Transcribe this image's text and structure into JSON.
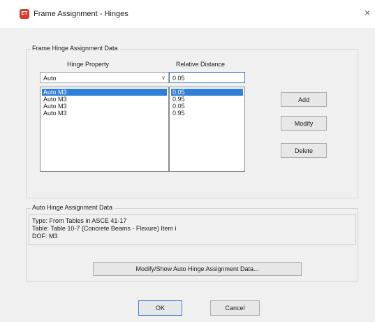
{
  "window": {
    "title": "Frame Assignment - Hinges",
    "app_icon": "ET",
    "close_glyph": "×"
  },
  "hinge_group": {
    "label": "Frame Hinge Assignment Data",
    "col_property": "Hinge Property",
    "col_distance": "Relative Distance",
    "property_select": {
      "value": "Auto",
      "arrow": "∨"
    },
    "distance_input": "0.05",
    "rows": [
      {
        "property": "Auto  M3",
        "distance": "0.05",
        "selected": true
      },
      {
        "property": "Auto  M3",
        "distance": "0.95",
        "selected": false
      },
      {
        "property": "Auto  M3",
        "distance": "0.05",
        "selected": false
      },
      {
        "property": "Auto  M3",
        "distance": "0.95",
        "selected": false
      }
    ],
    "buttons": {
      "add": "Add",
      "modify": "Modify",
      "delete": "Delete"
    }
  },
  "auto_group": {
    "label": "Auto Hinge Assignment Data",
    "lines": [
      "Type:  From Tables in ASCE 41-17",
      "Table:  Table 10-7 (Concrete Beams - Flexure) Item i",
      "DOF:  M3"
    ],
    "modify_show_button": "Modify/Show Auto Hinge Assignment Data..."
  },
  "footer": {
    "ok": "OK",
    "cancel": "Cancel"
  },
  "colors": {
    "selection": "#2f7fd6",
    "focus_border": "#3c7fd6",
    "app_icon": "#d83a2e"
  }
}
